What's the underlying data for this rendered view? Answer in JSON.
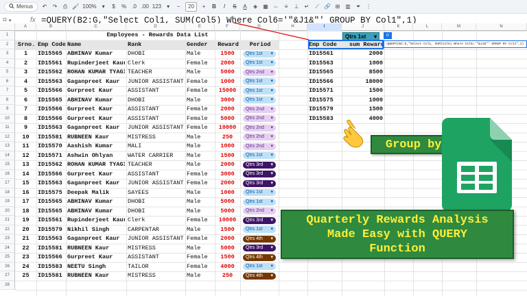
{
  "toolbar": {
    "menus_label": "Menus",
    "zoom": "100%",
    "currency": "$",
    "percent": "%",
    "dec_dec": ".0",
    "dec_inc": ".00",
    "num_format": "123",
    "font_size": "20",
    "bold": "B",
    "italic": "I",
    "strike": "S",
    "text_color": "A"
  },
  "formula_bar": {
    "cell_ref": "I2",
    "fx": "fx",
    "formula": "=QUERY(B2:G,\"Select Col1, SUM(Col5) Where Col6='\"&J1&\"' GROUP BY Col1\",1)"
  },
  "columns": [
    "A",
    "B",
    "C",
    "D",
    "E",
    "F",
    "G",
    "H",
    "I",
    "J",
    "K",
    "L",
    "M",
    "N"
  ],
  "row_numbers": [
    "1",
    "2",
    "3",
    "4",
    "5",
    "6",
    "7",
    "8",
    "9",
    "10",
    "11",
    "12",
    "13",
    "14",
    "15",
    "16",
    "17",
    "18",
    "19",
    "20",
    "21",
    "22",
    "23",
    "24",
    "25",
    "26",
    "27",
    "28"
  ],
  "sheet": {
    "title": "Employees - Rewards Data List",
    "headers": [
      "Srno.",
      "Emp Code",
      "Name",
      "Rank",
      "Gender",
      "Reward",
      "Period"
    ],
    "rows": [
      [
        "1",
        "ID15565",
        "ABHINAV Kumar",
        "DHOBI",
        "Male",
        "1500",
        "Qtrs 1st"
      ],
      [
        "2",
        "ID15561",
        "Rupinderjeet Kaur",
        "Clerk",
        "Female",
        "2000",
        "Qtrs 1st"
      ],
      [
        "3",
        "ID15562",
        "ROHAN KUMAR TYAGI",
        "TEACHER",
        "Male",
        "5000",
        "Qtrs 2nd"
      ],
      [
        "4",
        "ID15563",
        "Gaganpreet Kaur",
        "JUNIOR ASSISTANT",
        "Female",
        "1000",
        "Qtrs 1st"
      ],
      [
        "5",
        "ID15566",
        "Gurpreet Kaur",
        "ASSISTANT",
        "Female",
        "15000",
        "Qtrs 1st"
      ],
      [
        "6",
        "ID15565",
        "ABHINAV Kumar",
        "DHOBI",
        "Male",
        "3000",
        "Qtrs 1st"
      ],
      [
        "7",
        "ID15566",
        "Gurpreet Kaur",
        "ASSISTANT",
        "Female",
        "2000",
        "Qtrs 2nd"
      ],
      [
        "8",
        "ID15566",
        "Gurpreet Kaur",
        "ASSISTANT",
        "Female",
        "5000",
        "Qtrs 2nd"
      ],
      [
        "9",
        "ID15563",
        "Gaganpreet Kaur",
        "JUNIOR ASSISTANT",
        "Female",
        "10000",
        "Qtrs 2nd"
      ],
      [
        "10",
        "ID15581",
        "RUBNEEN Kaur",
        "MISTRESS",
        "Male",
        "250",
        "Qtrs 2nd"
      ],
      [
        "11",
        "ID15570",
        "Aashish Kumar",
        "MALI",
        "Male",
        "1000",
        "Qtrs 2nd"
      ],
      [
        "12",
        "ID15571",
        "Ashwin Ohlyan",
        "WATER CARRIER",
        "Male",
        "1500",
        "Qtrs 1st"
      ],
      [
        "13",
        "ID15562",
        "ROHAN KUMAR TYAGI",
        "TEACHER",
        "Male",
        "2000",
        "Qtrs 3rd"
      ],
      [
        "14",
        "ID15566",
        "Gurpreet Kaur",
        "ASSISTANT",
        "Female",
        "3000",
        "Qtrs 3rd"
      ],
      [
        "15",
        "ID15563",
        "Gaganpreet Kaur",
        "JUNIOR ASSISTANT",
        "Female",
        "2000",
        "Qtrs 3rd"
      ],
      [
        "16",
        "ID15575",
        "Deepak Malik",
        "SAYEES",
        "Male",
        "1000",
        "Qtrs 1st"
      ],
      [
        "17",
        "ID15565",
        "ABHINAV Kumar",
        "DHOBI",
        "Male",
        "5000",
        "Qtrs 1st"
      ],
      [
        "18",
        "ID15565",
        "ABHINAV Kumar",
        "DHOBI",
        "Male",
        "5000",
        "Qtrs 2nd"
      ],
      [
        "19",
        "ID15561",
        "Rupinderjeet Kaur",
        "Clerk",
        "Female",
        "10000",
        "Qtrs 3rd"
      ],
      [
        "20",
        "ID15579",
        "Nikhil Singh",
        "CARPENTAR",
        "Male",
        "1500",
        "Qtrs 1st"
      ],
      [
        "21",
        "ID15563",
        "Gaganpreet Kaur",
        "JUNIOR ASSISTANT",
        "Female",
        "2000",
        "Qtrs 4th"
      ],
      [
        "22",
        "ID15581",
        "RUBNEEN Kaur",
        "MISTRESS",
        "Male",
        "5000",
        "Qtrs 3rd"
      ],
      [
        "23",
        "ID15566",
        "Gurpreet Kaur",
        "ASSISTANT",
        "Female",
        "1500",
        "Qtrs 4th"
      ],
      [
        "24",
        "ID15583",
        "NEETU Singh",
        "TAILOR",
        "Female",
        "4000",
        "Qtrs 1st"
      ],
      [
        "25",
        "ID15581",
        "RUBNEEN Kaur",
        "MISTRESS",
        "Male",
        "250",
        "Qtrs 4th"
      ]
    ]
  },
  "query": {
    "selected_period": "Qtrs 1st",
    "headers": [
      "Emp Code",
      "sum Reward"
    ],
    "rows": [
      [
        "ID15561",
        "2000"
      ],
      [
        "ID15563",
        "1000"
      ],
      [
        "ID15565",
        "8500"
      ],
      [
        "ID15566",
        "18000"
      ],
      [
        "ID15571",
        "1500"
      ],
      [
        "ID15575",
        "1000"
      ],
      [
        "ID15579",
        "1500"
      ],
      [
        "ID15583",
        "4000"
      ]
    ],
    "active_cell_tag": "I2",
    "tooltip": "=QUERY(B2:G,\"Select Col1, SUM(Col5) Where Col6='\"&J1&\"' GROUP BY Col1\",1)"
  },
  "overlay": {
    "banner1": "Group by ID",
    "banner2_lines": [
      "Quarterly Rewards Analysis",
      "Made Easy with QUERY",
      "Function"
    ]
  },
  "colors": {
    "q1_bg": "#bfe1f6",
    "q2_bg": "#e6cff2",
    "q3_bg": "#3d1466",
    "q4_bg": "#753800",
    "reward_red": "#e00000",
    "banner_green": "#2f8a3f",
    "banner_text": "#ffef3a"
  }
}
